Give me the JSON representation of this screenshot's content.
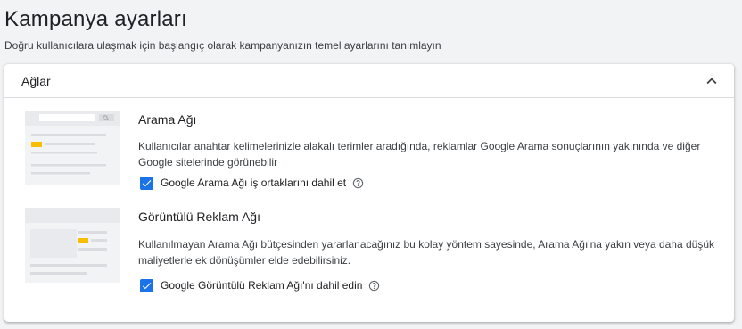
{
  "page": {
    "title": "Kampanya ayarları",
    "subtitle": "Doğru kullanıcılara ulaşmak için başlangıç olarak kampanyanızın temel ayarlarını tanımlayın"
  },
  "networks_panel": {
    "title": "Ağlar",
    "expanded": true,
    "icons": {
      "collapse": "chevron-up-icon",
      "help": "help-circle-icon",
      "check": "check-icon"
    },
    "colors": {
      "accent": "#1a73e8",
      "thumb_highlight": "#fbbc04"
    },
    "search": {
      "title": "Arama Ağı",
      "description": "Kullanıcılar anahtar kelimelerinizle alakalı terimler aradığında, reklamlar Google Arama sonuçlarının yakınında ve diğer Google sitelerinde görünebilir",
      "checkbox_label": "Google Arama Ağı iş ortaklarını dahil et",
      "checked": true
    },
    "display": {
      "title": "Görüntülü Reklam Ağı",
      "description": "Kullanılmayan Arama Ağı bütçesinden yararlanacağınız bu kolay yöntem sayesinde, Arama Ağı'na yakın veya daha düşük maliyetlerle ek dönüşümler elde edebilirsiniz.",
      "checkbox_label": "Google Görüntülü Reklam Ağı'nı dahil edin",
      "checked": true
    }
  }
}
